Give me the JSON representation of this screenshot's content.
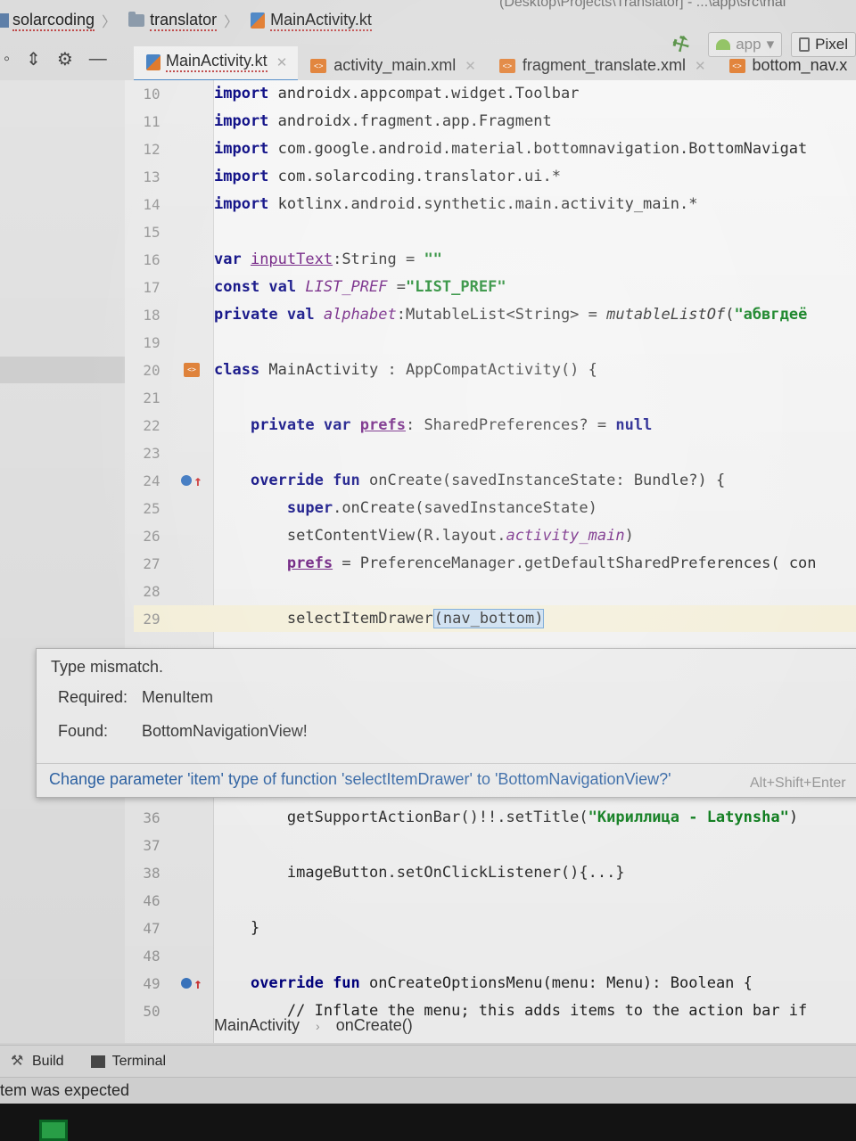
{
  "window": {
    "title_path": "(Desktop\\Projects\\Translator] - ...\\app\\src\\mai"
  },
  "navbar": {
    "project": "solarcoding",
    "module": "translator",
    "file": "MainActivity.kt"
  },
  "run": {
    "config": "app",
    "device": "Pixel"
  },
  "tabs": [
    {
      "label": "MainActivity.kt",
      "active": true
    },
    {
      "label": "activity_main.xml",
      "active": false
    },
    {
      "label": "fragment_translate.xml",
      "active": false
    },
    {
      "label": "bottom_nav.x",
      "active": false
    }
  ],
  "editor": {
    "lines": [
      {
        "n": "10",
        "t": [
          [
            "kw",
            "import"
          ],
          [
            "p",
            " androidx.appcompat.widget.Toolbar"
          ]
        ]
      },
      {
        "n": "11",
        "t": [
          [
            "kw",
            "import"
          ],
          [
            "p",
            " androidx.fragment.app.Fragment"
          ]
        ]
      },
      {
        "n": "12",
        "t": [
          [
            "kw",
            "import"
          ],
          [
            "p",
            " com.google.android.material.bottomnavigation.BottomNavigat"
          ]
        ]
      },
      {
        "n": "13",
        "t": [
          [
            "kw",
            "import"
          ],
          [
            "p",
            " com.solarcoding.translator.ui.*"
          ]
        ]
      },
      {
        "n": "14",
        "t": [
          [
            "kw",
            "import"
          ],
          [
            "p",
            " kotlinx.android.synthetic.main.activity_main.*"
          ]
        ]
      },
      {
        "n": "15",
        "t": []
      },
      {
        "n": "16",
        "t": [
          [
            "kw",
            "var "
          ],
          [
            "fldu",
            "inputText"
          ],
          [
            "p",
            ":String = "
          ],
          [
            "str",
            "\"\""
          ]
        ]
      },
      {
        "n": "17",
        "t": [
          [
            "kw",
            "const val "
          ],
          [
            "const",
            "LIST_PREF"
          ],
          [
            "p",
            " ="
          ],
          [
            "str",
            "\"LIST_PREF\""
          ]
        ]
      },
      {
        "n": "18",
        "t": [
          [
            "kw",
            "private val "
          ],
          [
            "fld",
            "alphabet"
          ],
          [
            "p",
            ":MutableList<String> = "
          ],
          [
            "it",
            "mutableListOf"
          ],
          [
            "p",
            "("
          ],
          [
            "str",
            "\"абвгдеё"
          ]
        ]
      },
      {
        "n": "19",
        "t": []
      },
      {
        "n": "20",
        "t": [
          [
            "kw",
            "class "
          ],
          [
            "p",
            "MainActivity : AppCompatActivity() {"
          ]
        ],
        "marker": "class"
      },
      {
        "n": "21",
        "t": []
      },
      {
        "n": "22",
        "t": [
          [
            "p",
            "    "
          ],
          [
            "kw",
            "private var "
          ],
          [
            "fldb",
            "prefs"
          ],
          [
            "p",
            ": SharedPreferences? = "
          ],
          [
            "kw",
            "null"
          ]
        ]
      },
      {
        "n": "23",
        "t": []
      },
      {
        "n": "24",
        "t": [
          [
            "p",
            "    "
          ],
          [
            "kw",
            "override fun "
          ],
          [
            "p",
            "onCreate(savedInstanceState: Bundle?) {"
          ]
        ],
        "marker": "override"
      },
      {
        "n": "25",
        "t": [
          [
            "p",
            "        "
          ],
          [
            "kw",
            "super"
          ],
          [
            "p",
            ".onCreate(savedInstanceState)"
          ]
        ]
      },
      {
        "n": "26",
        "t": [
          [
            "p",
            "        setContentView(R.layout."
          ],
          [
            "fld",
            "activity_main"
          ],
          [
            "p",
            ")"
          ]
        ]
      },
      {
        "n": "27",
        "t": [
          [
            "p",
            "        "
          ],
          [
            "fldb",
            "prefs"
          ],
          [
            "p",
            " = PreferenceManager.getDefaultSharedPreferences( con"
          ]
        ]
      },
      {
        "n": "28",
        "t": []
      },
      {
        "n": "29",
        "t": [
          [
            "p",
            "        selectItemDrawer"
          ],
          [
            "sel",
            "(nav_bottom)"
          ]
        ],
        "cursor": true
      },
      {
        "n": "36",
        "t": [
          [
            "p",
            "        getSupportActionBar()!!.setTitle("
          ],
          [
            "str",
            "\"Кириллица - Latynsha\""
          ],
          [
            "p",
            ")"
          ]
        ]
      },
      {
        "n": "37",
        "t": []
      },
      {
        "n": "38",
        "t": [
          [
            "p",
            "        imageButton.setOnClickListener(){...}"
          ]
        ]
      },
      {
        "n": "46",
        "t": []
      },
      {
        "n": "47",
        "t": [
          [
            "p",
            "    }"
          ]
        ]
      },
      {
        "n": "48",
        "t": []
      },
      {
        "n": "49",
        "t": [
          [
            "p",
            "    "
          ],
          [
            "kw",
            "override fun "
          ],
          [
            "p",
            "onCreateOptionsMenu(menu: Menu): Boolean {"
          ]
        ],
        "marker": "override"
      },
      {
        "n": "50",
        "t": [
          [
            "p",
            "        // Inflate the menu; this adds items to the action bar if"
          ]
        ]
      }
    ]
  },
  "tooltip": {
    "title": "Type mismatch.",
    "required_label": "Required:",
    "required_value": "MenuItem",
    "found_label": "Found:",
    "found_value": "BottomNavigationView!",
    "fix": "Change parameter 'item' type of function 'selectItemDrawer' to 'BottomNavigationView?'",
    "shortcut": "Alt+Shift+Enter"
  },
  "codecrumbs": {
    "class": "MainActivity",
    "method": "onCreate()"
  },
  "toolwindows": {
    "build": "Build",
    "terminal": "Terminal"
  },
  "status": {
    "message": "tem was expected"
  }
}
